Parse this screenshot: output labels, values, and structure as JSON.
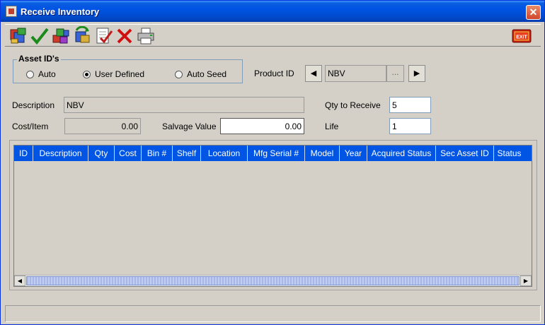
{
  "window": {
    "title": "Receive Inventory",
    "icon": "app-icon",
    "close_glyph": "✕"
  },
  "toolbar": {
    "buttons": [
      {
        "name": "new-record-button",
        "icon": "toolbox-icon"
      },
      {
        "name": "accept-button",
        "icon": "checkmark-icon"
      },
      {
        "name": "add-items-button",
        "icon": "boxes-icon"
      },
      {
        "name": "transfer-button",
        "icon": "cycle-icon"
      },
      {
        "name": "checklist-button",
        "icon": "checklist-icon"
      },
      {
        "name": "delete-button",
        "icon": "red-x-icon"
      },
      {
        "name": "print-button",
        "icon": "printer-icon"
      }
    ],
    "exit_label": "EXIT"
  },
  "asset_ids": {
    "legend": "Asset ID's",
    "options": [
      {
        "label": "Auto",
        "checked": false
      },
      {
        "label": "User Defined",
        "checked": true
      },
      {
        "label": "Auto Seed",
        "checked": false
      }
    ]
  },
  "product": {
    "label": "Product ID",
    "value": "NBV",
    "browse_label": "...",
    "prev_glyph": "◀",
    "next_glyph": "▶"
  },
  "description": {
    "label": "Description",
    "value": "NBV"
  },
  "cost_item": {
    "label": "Cost/Item",
    "value": "0.00"
  },
  "salvage": {
    "label": "Salvage Value",
    "value": "0.00"
  },
  "qty_receive": {
    "label": "Qty to Receive",
    "value": "5"
  },
  "life": {
    "label": "Life",
    "value": "1"
  },
  "table": {
    "columns": [
      "ID",
      "Description",
      "Qty",
      "Cost",
      "Bin #",
      "Shelf",
      "Location",
      "Mfg Serial #",
      "Model",
      "Year",
      "Acquired Status",
      "Sec Asset ID",
      "Status"
    ],
    "rows": [],
    "scroll_left_glyph": "◀",
    "scroll_right_glyph": "▶"
  },
  "colors": {
    "header_bg": "#0055e5",
    "window_bg": "#d4d0c8",
    "title_bar": "#0054e3"
  }
}
